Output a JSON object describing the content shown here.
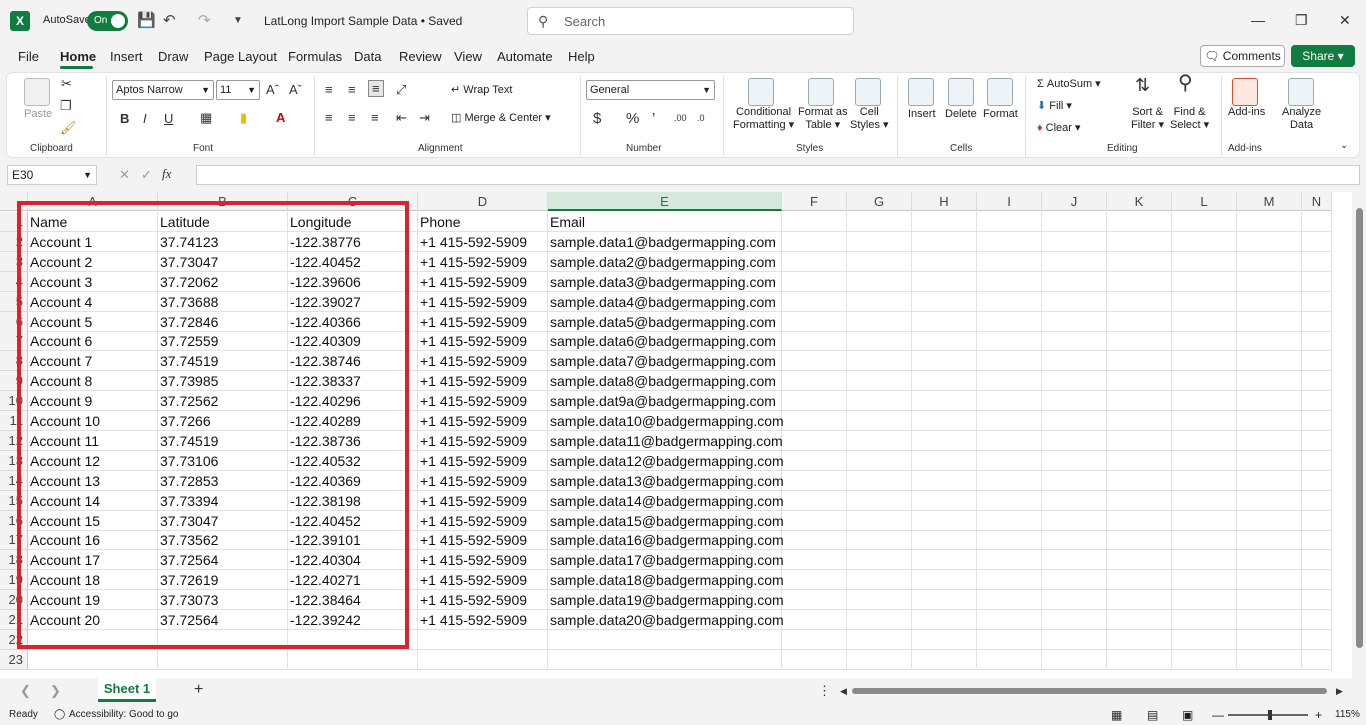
{
  "app": {
    "logo": "X",
    "autosave_label": "AutoSave",
    "autosave_state": "On",
    "doc_title": "LatLong Import Sample Data • Saved",
    "search_placeholder": "Search"
  },
  "menu": {
    "tabs": [
      "File",
      "Home",
      "Insert",
      "Draw",
      "Page Layout",
      "Formulas",
      "Data",
      "Review",
      "View",
      "Automate",
      "Help"
    ],
    "active": "Home",
    "comments_label": "Comments",
    "share_label": "Share"
  },
  "ribbon": {
    "clipboard": {
      "group": "Clipboard",
      "paste": "Paste"
    },
    "font": {
      "group": "Font",
      "name": "Aptos Narrow",
      "size": "11"
    },
    "alignment": {
      "group": "Alignment",
      "wrap": "Wrap Text",
      "merge": "Merge & Center"
    },
    "number": {
      "group": "Number",
      "format": "General"
    },
    "styles": {
      "group": "Styles",
      "cond1": "Conditional",
      "cond2": "Formatting",
      "fat1": "Format as",
      "fat2": "Table",
      "cs1": "Cell",
      "cs2": "Styles"
    },
    "cells": {
      "group": "Cells",
      "insert": "Insert",
      "delete": "Delete",
      "format": "Format"
    },
    "editing": {
      "group": "Editing",
      "autosum": "AutoSum",
      "fill": "Fill",
      "clear": "Clear",
      "sort1": "Sort &",
      "sort2": "Filter",
      "find1": "Find &",
      "find2": "Select"
    },
    "addins": {
      "group": "Add-ins",
      "addins": "Add-ins",
      "an1": "Analyze",
      "an2": "Data"
    }
  },
  "formula_bar": {
    "name_box": "E30",
    "fx": "fx",
    "value": ""
  },
  "columns": [
    "A",
    "B",
    "C",
    "D",
    "E",
    "F",
    "G",
    "H",
    "I",
    "J",
    "K",
    "L",
    "M",
    "N"
  ],
  "selected_column": "E",
  "rows": [
    [
      "Name",
      "Latitude",
      "Longitude",
      "Phone",
      "Email"
    ],
    [
      "Account 1",
      "37.74123",
      "-122.38776",
      "+1 415-592-5909",
      "sample.data1@badgermapping.com"
    ],
    [
      "Account 2",
      "37.73047",
      "-122.40452",
      "+1 415-592-5909",
      "sample.data2@badgermapping.com"
    ],
    [
      "Account 3",
      "37.72062",
      "-122.39606",
      "+1 415-592-5909",
      "sample.data3@badgermapping.com"
    ],
    [
      "Account 4",
      "37.73688",
      "-122.39027",
      "+1 415-592-5909",
      "sample.data4@badgermapping.com"
    ],
    [
      "Account 5",
      "37.72846",
      "-122.40366",
      "+1 415-592-5909",
      "sample.data5@badgermapping.com"
    ],
    [
      "Account 6",
      "37.72559",
      "-122.40309",
      "+1 415-592-5909",
      "sample.data6@badgermapping.com"
    ],
    [
      "Account 7",
      "37.74519",
      "-122.38746",
      "+1 415-592-5909",
      "sample.data7@badgermapping.com"
    ],
    [
      "Account 8",
      "37.73985",
      "-122.38337",
      "+1 415-592-5909",
      "sample.data8@badgermapping.com"
    ],
    [
      "Account 9",
      "37.72562",
      "-122.40296",
      "+1 415-592-5909",
      "sample.dat9a@badgermapping.com"
    ],
    [
      "Account 10",
      "37.7266",
      "-122.40289",
      "+1 415-592-5909",
      "sample.data10@badgermapping.com"
    ],
    [
      "Account 11",
      "37.74519",
      "-122.38736",
      "+1 415-592-5909",
      "sample.data11@badgermapping.com"
    ],
    [
      "Account 12",
      "37.73106",
      "-122.40532",
      "+1 415-592-5909",
      "sample.data12@badgermapping.com"
    ],
    [
      "Account 13",
      "37.72853",
      "-122.40369",
      "+1 415-592-5909",
      "sample.data13@badgermapping.com"
    ],
    [
      "Account 14",
      "37.73394",
      "-122.38198",
      "+1 415-592-5909",
      "sample.data14@badgermapping.com"
    ],
    [
      "Account 15",
      "37.73047",
      "-122.40452",
      "+1 415-592-5909",
      "sample.data15@badgermapping.com"
    ],
    [
      "Account 16",
      "37.73562",
      "-122.39101",
      "+1 415-592-5909",
      "sample.data16@badgermapping.com"
    ],
    [
      "Account 17",
      "37.72564",
      "-122.40304",
      "+1 415-592-5909",
      "sample.data17@badgermapping.com"
    ],
    [
      "Account 18",
      "37.72619",
      "-122.40271",
      "+1 415-592-5909",
      "sample.data18@badgermapping.com"
    ],
    [
      "Account 19",
      "37.73073",
      "-122.38464",
      "+1 415-592-5909",
      "sample.data19@badgermapping.com"
    ],
    [
      "Account 20",
      "37.72564",
      "-122.39242",
      "+1 415-592-5909",
      "sample.data20@badgermapping.com"
    ],
    [
      "",
      "",
      "",
      "",
      ""
    ],
    [
      "",
      "",
      "",
      "",
      ""
    ]
  ],
  "sheet_tab": "Sheet 1",
  "status": {
    "ready": "Ready",
    "accessibility": "Accessibility: Good to go",
    "zoom": "115%"
  },
  "colors": {
    "accent": "#107c41",
    "highlight": "#d9232e"
  }
}
